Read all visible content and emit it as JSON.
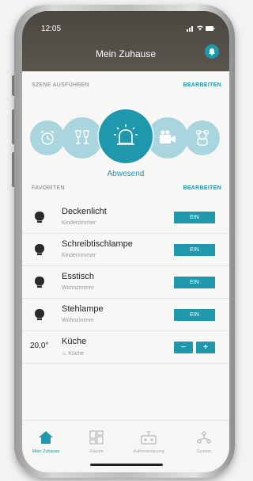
{
  "status_bar": {
    "time": "12:05",
    "icons": "▪▪▪ ≈ ▬"
  },
  "header": {
    "title": "Mein Zuhause",
    "bell_icon": "bell-icon"
  },
  "scenes": {
    "section_label": "SZENE AUSFÜHREN",
    "edit_label": "BEARBEITEN",
    "active_label": "Abwesend",
    "items": [
      {
        "icon": "alarm-clock-icon"
      },
      {
        "icon": "glasses-icon"
      },
      {
        "icon": "siren-icon",
        "active": true
      },
      {
        "icon": "camera-icon"
      },
      {
        "icon": "teddy-bear-icon"
      }
    ]
  },
  "favorites": {
    "section_label": "FAVORITEN",
    "edit_label": "BEARBEITEN",
    "items": [
      {
        "name": "Deckenlicht",
        "room": "Kinderzimmer",
        "button": "EIN",
        "icon": "bulb-icon"
      },
      {
        "name": "Schreibtischlampe",
        "room": "Kinderzimmer",
        "button": "EIN",
        "icon": "bulb-icon"
      },
      {
        "name": "Esstisch",
        "room": "Wohnzimmer",
        "button": "EIN",
        "icon": "bulb-icon"
      },
      {
        "name": "Stehlampe",
        "room": "Wohnzimmer",
        "button": "EIN",
        "icon": "bulb-icon"
      }
    ],
    "thermostat": {
      "value": "20,0°",
      "name": "Küche",
      "room": "Küche",
      "minus": "−",
      "plus": "+"
    }
  },
  "tabbar": {
    "tabs": [
      {
        "label": "Mein Zuhause",
        "icon": "home-icon",
        "active": true
      },
      {
        "label": "Räume",
        "icon": "rooms-icon"
      },
      {
        "label": "Automatisierung",
        "icon": "automation-icon"
      },
      {
        "label": "System",
        "icon": "system-icon"
      }
    ]
  },
  "colors": {
    "accent": "#1f97ac",
    "accent_light": "#a9d6de",
    "header": "#4a4740"
  }
}
